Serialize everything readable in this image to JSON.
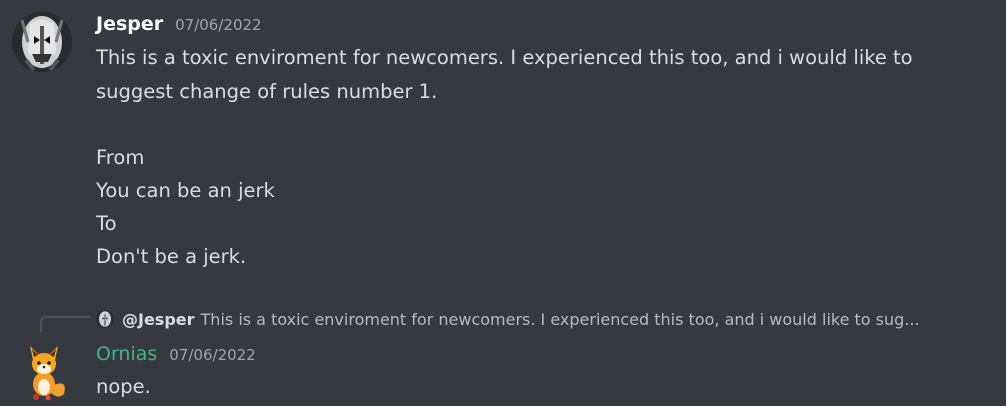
{
  "messages": [
    {
      "username": "Jesper",
      "timestamp": "07/06/2022",
      "avatar_icon": "skull-mask-avatar-icon",
      "lines": [
        "This is a toxic enviroment for newcomers. I experienced this too, and i would like to",
        "suggest change of rules number 1.",
        "",
        "From",
        "You can be an jerk",
        "To",
        "Don't be a jerk."
      ]
    },
    {
      "reply": {
        "username": "@Jesper",
        "preview": "This is a toxic enviroment for newcomers. I experienced this too, and i would like to sug..."
      },
      "username": "Ornias",
      "username_color": "#43b581",
      "timestamp": "07/06/2022",
      "avatar_icon": "fox-avatar-icon",
      "lines": [
        "nope."
      ]
    }
  ]
}
